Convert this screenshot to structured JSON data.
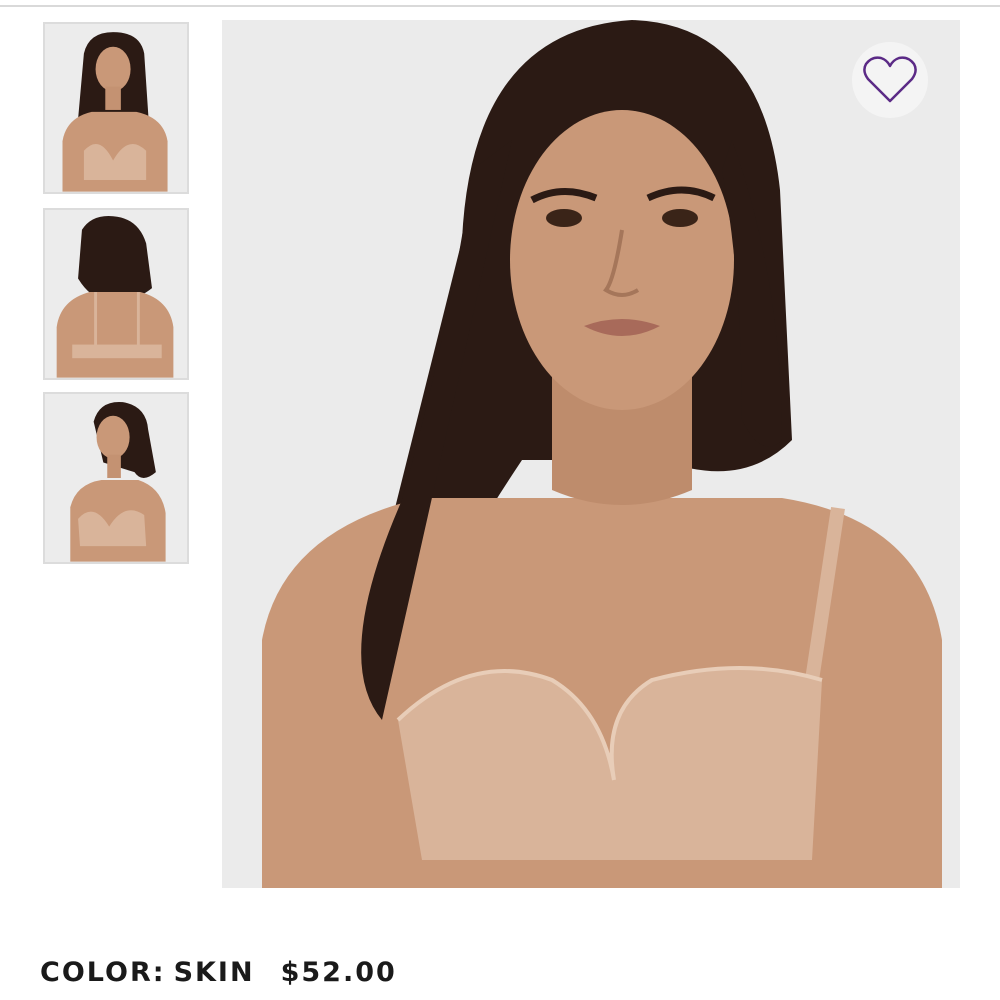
{
  "product": {
    "color_label": "COLOR:",
    "color_value": "SKIN",
    "price": "$52.00"
  },
  "gallery": {
    "thumbnails": [
      {
        "view": "front"
      },
      {
        "view": "back"
      },
      {
        "view": "three-quarter"
      }
    ],
    "selected_index": 0
  },
  "favorite": {
    "icon": "heart-outline-icon",
    "color": "#5b2a86"
  },
  "colors": {
    "skin_tone": "#c99878",
    "hair": "#2b1a14",
    "garment": "#d9b49a",
    "backdrop": "#ebebeb"
  }
}
